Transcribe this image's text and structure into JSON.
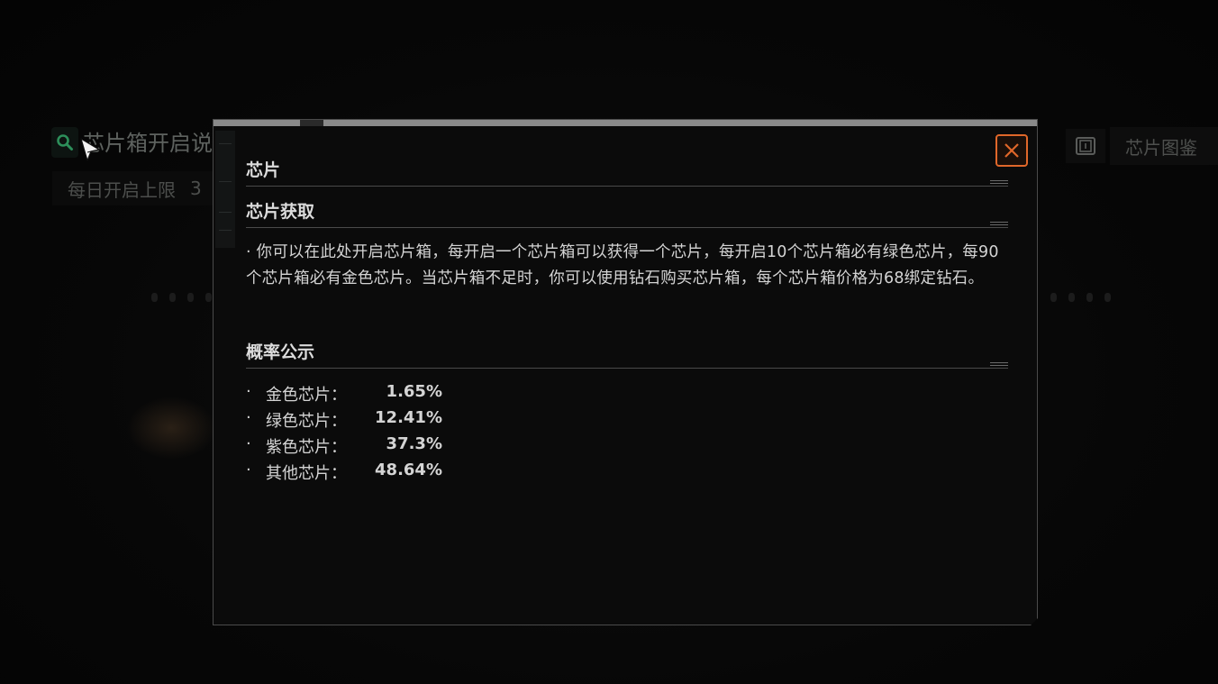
{
  "background": {
    "title": "芯片箱开启说",
    "daily_limit_label": "每日开启上限",
    "daily_limit_value": "3",
    "codex_label": "芯片图鉴"
  },
  "modal": {
    "title": "芯片",
    "sections": {
      "acquire": {
        "heading": "芯片获取",
        "text": "·  你可以在此处开启芯片箱，每开启一个芯片箱可以获得一个芯片，每开启10个芯片箱必有绿色芯片，每90个芯片箱必有金色芯片。当芯片箱不足时，你可以使用钻石购买芯片箱，每个芯片箱价格为68绑定钻石。"
      },
      "probability": {
        "heading": "概率公示",
        "items": [
          {
            "bullet": "·",
            "name": "金色芯片：",
            "value": "1.65%"
          },
          {
            "bullet": "·",
            "name": "绿色芯片：",
            "value": "12.41%"
          },
          {
            "bullet": "·",
            "name": "紫色芯片：",
            "value": "37.3%"
          },
          {
            "bullet": "·",
            "name": "其他芯片：",
            "value": "48.64%"
          }
        ]
      }
    }
  },
  "colors": {
    "accent_close": "#e0672a",
    "text": "#d4d4d4",
    "panel": "#0b0b0b"
  },
  "icons": [
    "search-icon",
    "close-icon",
    "codex-icon",
    "mouse-cursor-icon"
  ]
}
